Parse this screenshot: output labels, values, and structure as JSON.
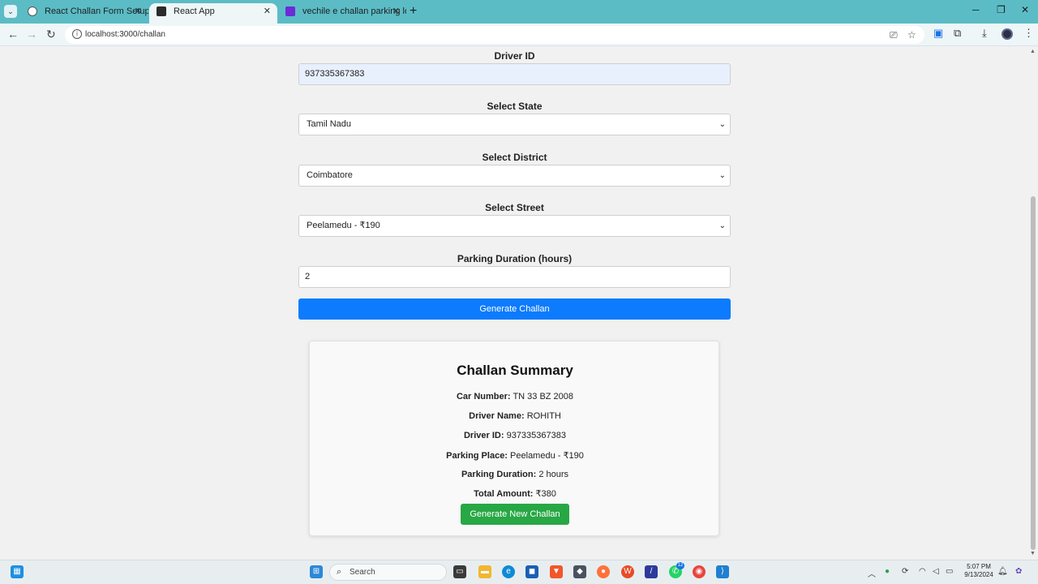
{
  "browser": {
    "tabs": [
      {
        "label": "React Challan Form Setup",
        "active": false
      },
      {
        "label": "React App",
        "active": true
      },
      {
        "label": "vechile e challan parking logo -",
        "active": false
      }
    ],
    "url": "localhost:3000/challan"
  },
  "form": {
    "driver_id_label": "Driver ID",
    "driver_id_value": "937335367383",
    "state_label": "Select State",
    "state_value": "Tamil Nadu",
    "district_label": "Select District",
    "district_value": "Coimbatore",
    "street_label": "Select Street",
    "street_value": "Peelamedu - ₹190",
    "duration_label": "Parking Duration (hours)",
    "duration_value": "2",
    "generate_button": "Generate Challan"
  },
  "summary": {
    "title": "Challan Summary",
    "rows": [
      {
        "label": "Car Number:",
        "value": "TN 33 BZ 2008"
      },
      {
        "label": "Driver Name:",
        "value": "ROHITH"
      },
      {
        "label": "Driver ID:",
        "value": "937335367383"
      },
      {
        "label": "Parking Place:",
        "value": "Peelamedu - ₹190"
      },
      {
        "label": "Parking Duration:",
        "value": "2 hours"
      },
      {
        "label": "Total Amount:",
        "value": "₹380"
      }
    ],
    "new_button": "Generate New Challan"
  },
  "taskbar": {
    "search_placeholder": "Search",
    "time": "5:07 PM",
    "date": "9/13/2024",
    "whatsapp_badge": "12"
  },
  "colors": {
    "primary_button": "#0d7bfd",
    "success_button": "#28a745",
    "tab_strip": "#5bbcc6"
  }
}
